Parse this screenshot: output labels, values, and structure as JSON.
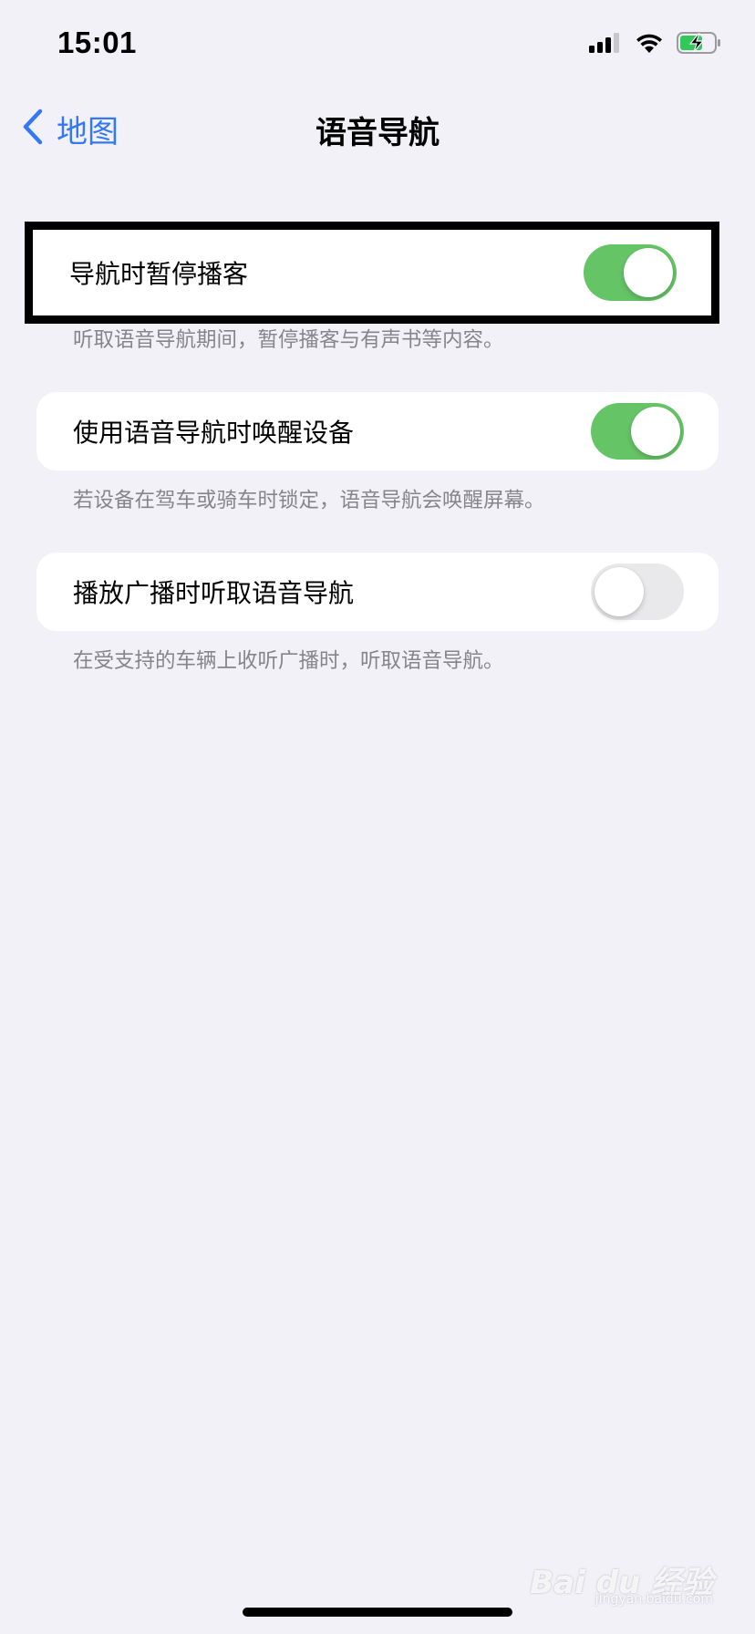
{
  "status_bar": {
    "time": "15:01",
    "icons": [
      "cellular-signal-icon",
      "wifi-icon",
      "battery-charging-icon"
    ]
  },
  "nav": {
    "back_label": "地图",
    "title": "语音导航"
  },
  "settings": [
    {
      "label": "导航时暂停播客",
      "enabled": true,
      "footer": "听取语音导航期间，暂停播客与有声书等内容。"
    },
    {
      "label": "使用语音导航时唤醒设备",
      "enabled": true,
      "footer": "若设备在驾车或骑车时锁定，语音导航会唤醒屏幕。"
    },
    {
      "label": "播放广播时听取语音导航",
      "enabled": false,
      "footer": "在受支持的车辆上收听广播时，听取语音导航。"
    }
  ],
  "watermark": {
    "text": "Bai du 经验",
    "sub": "jingyan.baidu.com"
  },
  "colors": {
    "accent": "#3478f6",
    "toggle_on": "#65c466",
    "toggle_off": "#e9e9eb",
    "background": "#f2f1f7",
    "footer_text": "#86858b"
  }
}
